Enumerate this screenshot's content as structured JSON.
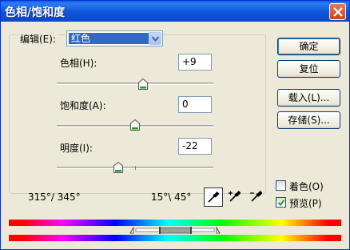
{
  "window": {
    "title": "色相/饱和度"
  },
  "edit": {
    "label": "编辑(E):",
    "value": "红色"
  },
  "params": {
    "hue": {
      "label": "色相(H):",
      "value": "+9"
    },
    "saturation": {
      "label": "饱和度(A):",
      "value": "0"
    },
    "lightness": {
      "label": "明度(I):",
      "value": "-22"
    }
  },
  "buttons": {
    "ok": "确定",
    "reset": "复位",
    "load": "载入(L)...",
    "save": "存储(S)..."
  },
  "options": {
    "colorize": {
      "label": "着色(O)",
      "checked": false
    },
    "preview": {
      "label": "预览(P)",
      "checked": true
    }
  },
  "range": {
    "left": "315°/ 345°",
    "right": "15°\\ 45°"
  },
  "icons": [
    "close-icon",
    "dropdown-arrow-icon",
    "eyedropper-icon",
    "eyedropper-plus-icon",
    "eyedropper-minus-icon",
    "slider-thumb-icon"
  ],
  "colors": {
    "titlebar": "#0a5fe0",
    "dialog": "#ece9d8",
    "selection": "#316ac5"
  }
}
